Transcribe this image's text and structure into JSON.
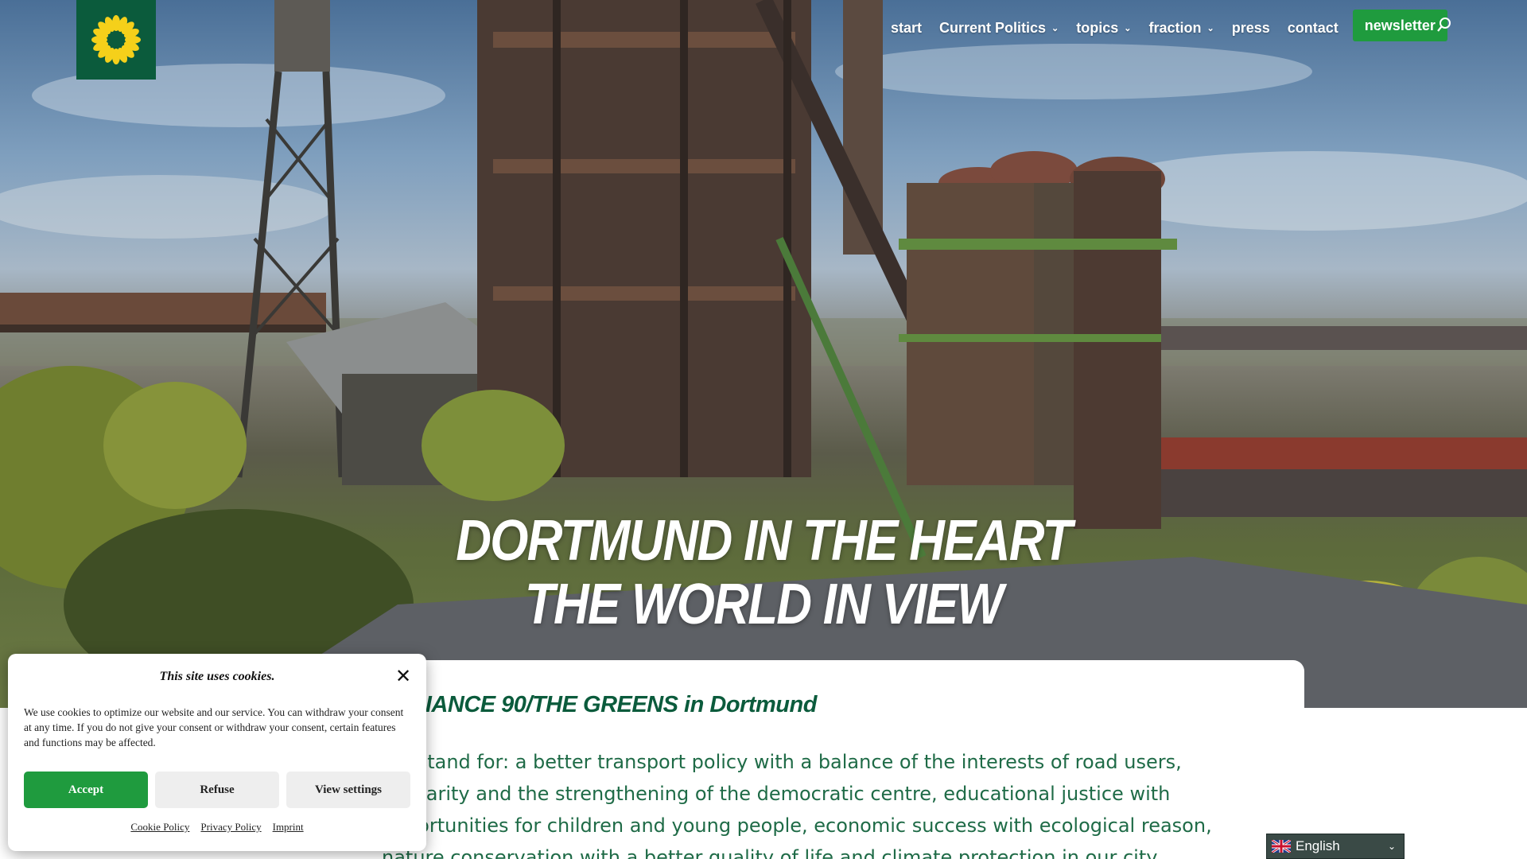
{
  "header": {
    "logo_icon": "sunflower-icon",
    "nav": [
      {
        "label": "start",
        "has_dropdown": false
      },
      {
        "label": "Current Politics",
        "has_dropdown": true
      },
      {
        "label": "topics",
        "has_dropdown": true
      },
      {
        "label": "fraction",
        "has_dropdown": true
      },
      {
        "label": "press",
        "has_dropdown": false
      },
      {
        "label": "contact",
        "has_dropdown": false
      }
    ],
    "newsletter_label": "newsletter",
    "search_icon": "search-icon"
  },
  "hero": {
    "title_line1": "DORTMUND IN THE HEART",
    "title_line2": "THE WORLD IN VIEW"
  },
  "content": {
    "heading": "ALLIANCE 90/THE GREENS in Dortmund",
    "text": "We stand for: a better transport policy with a balance of the interests of road users, solidarity and the strengthening of the democratic centre, educational justice with opportunities for children and young people, economic success with ecological reason, nature conservation with a better quality of life and climate protection in our city."
  },
  "cookie": {
    "title": "This site uses cookies.",
    "text": "We use cookies to optimize our website and our service. You can withdraw your consent at any time. If you do not give your consent or withdraw your consent, certain features and functions may be affected.",
    "accept_label": "Accept",
    "refuse_label": "Refuse",
    "settings_label": "View settings",
    "links": [
      "Cookie Policy",
      "Privacy Policy",
      "Imprint"
    ]
  },
  "language": {
    "selected": "English",
    "flag_icon": "uk-flag-icon"
  },
  "colors": {
    "brand_green": "#0b5b3c",
    "button_green": "#1f9b3e",
    "sunflower_yellow": "#f5d01a"
  }
}
